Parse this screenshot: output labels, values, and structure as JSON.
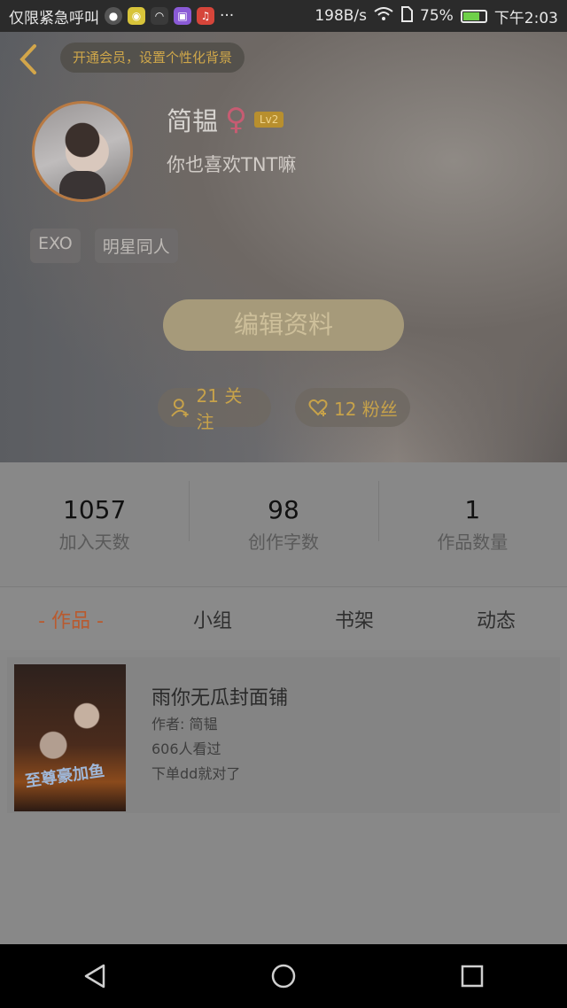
{
  "status_bar": {
    "carrier": "仅限紧急呼叫",
    "more": "···",
    "network_speed": "198B/s",
    "battery_percent": "75%",
    "time": "下午2:03"
  },
  "header": {
    "vip_prompt": "开通会员，设置个性化背景",
    "username": "简韫",
    "gender_symbol": "♀",
    "level": "Lv2",
    "signature": "你也喜欢TNT嘛",
    "tags": [
      "EXO",
      "明星同人"
    ],
    "edit_button": "编辑资料",
    "following": "21 关注",
    "followers": "12 粉丝"
  },
  "stats": [
    {
      "value": "1057",
      "label": "加入天数"
    },
    {
      "value": "98",
      "label": "创作字数"
    },
    {
      "value": "1",
      "label": "作品数量"
    }
  ],
  "tabs": [
    "- 作品 -",
    "小组",
    "书架",
    "动态"
  ],
  "works": [
    {
      "title": "雨你无瓜封面铺",
      "author": "作者: 简韫",
      "views": "606人看过",
      "description": "下单dd就对了",
      "cover_text": "至尊豪加鱼"
    }
  ],
  "colors": {
    "accent": "#c7a24a",
    "active_tab": "#b95a2e",
    "gender": "#c65c72"
  }
}
